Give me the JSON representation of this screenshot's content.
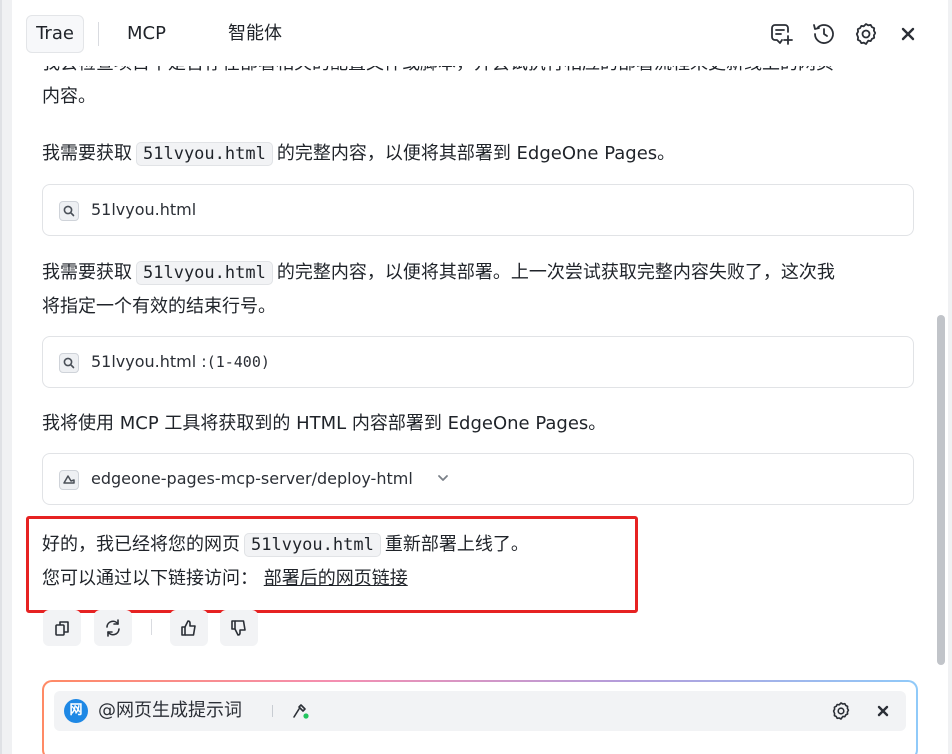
{
  "header": {
    "tabs": [
      {
        "label": "Trae",
        "active": true
      },
      {
        "label": "MCP"
      },
      {
        "label": "智能体"
      }
    ],
    "icons": [
      "new-chat-icon",
      "history-icon",
      "gear-icon",
      "close-icon"
    ]
  },
  "messages": {
    "clipped_line": "我会检查项目中是否存在部署相关的配置文件或脚本，并尝试执行相应的部署流程来更新线上的网页",
    "clipped_line_cont": "内容。",
    "msg1": {
      "prefix": "我需要获取",
      "file": "51lvyou.html",
      "suffix": "的完整内容，以便将其部署到 EdgeOne Pages。"
    },
    "tool1": {
      "text": "51lvyou.html",
      "icon": "search-icon"
    },
    "msg2": {
      "prefix": "我需要获取",
      "file": "51lvyou.html",
      "suffix": "的完整内容，以便将其部署。上一次尝试获取完整内容失败了，这次我",
      "line2": "将指定一个有效的结束行号。"
    },
    "tool2": {
      "text": "51lvyou.html :",
      "range": "(1-400)",
      "icon": "search-icon"
    },
    "msg3": "我将使用 MCP 工具将获取到的 HTML 内容部署到 EdgeOne Pages。",
    "tool3": {
      "text": "edgeone-pages-mcp-server/deploy-html",
      "icon": "mcp-tool-icon"
    },
    "final": {
      "prefix": "好的，我已经将您的网页",
      "file": "51lvyou.html",
      "suffix": "重新部署上线了。",
      "line2_prefix": "您可以通过以下链接访问：",
      "link": "部署后的网页链接"
    }
  },
  "actions": [
    "copy-icon",
    "refresh-icon",
    "thumbs-up-icon",
    "thumbs-down-icon"
  ],
  "input": {
    "context_label": "@网页生成提示词",
    "logo_char": "网"
  },
  "colors": {
    "highlight_box": "#e62222",
    "accent_blue": "#1e88e5",
    "tool_green": "#22c55e"
  }
}
